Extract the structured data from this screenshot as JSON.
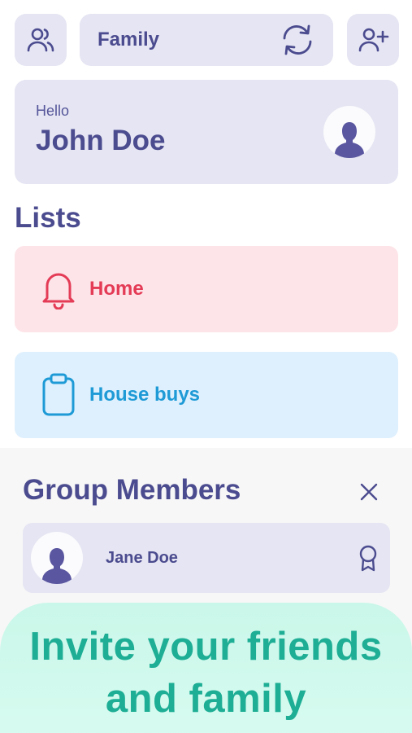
{
  "header": {
    "group_name": "Family",
    "icons": {
      "members": "people-icon",
      "switch": "refresh-icon",
      "add_user": "add-user-icon"
    }
  },
  "greeting": {
    "hello": "Hello",
    "name": "John Doe",
    "avatar_icon": "user-silhouette-icon"
  },
  "lists": {
    "title": "Lists",
    "items": [
      {
        "label": "Home",
        "icon": "bell-icon",
        "color": "#e43b56",
        "background": "#fde4e8"
      },
      {
        "label": "House buys",
        "icon": "clipboard-icon",
        "color": "#1e9ad6",
        "background": "#def0fd"
      }
    ]
  },
  "group_members": {
    "title": "Group Members",
    "close_icon": "close-icon",
    "members": [
      {
        "name": "Jane Doe",
        "badge_icon": "award-icon"
      }
    ]
  },
  "promo": {
    "line1": "Invite your friends",
    "line2": "and family",
    "color": "#1eae95"
  },
  "colors": {
    "primary": "#4b4b8f",
    "card": "#e5e5f3",
    "accent_green": "#1eae95"
  }
}
